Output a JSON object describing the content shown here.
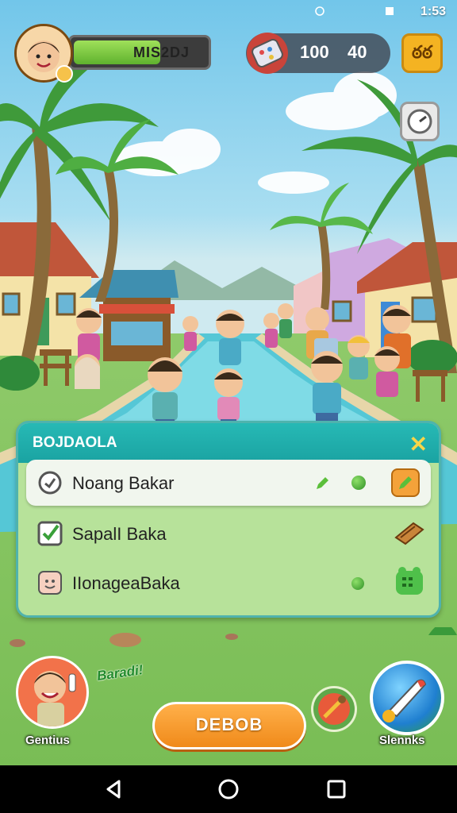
{
  "status_bar": {
    "time": "1:53"
  },
  "hud": {
    "player_name": "MIS2DJ",
    "xp_fraction": 0.65,
    "currency_a": "100",
    "currency_b": "40",
    "menu_glyph": "ఠఠ"
  },
  "panel": {
    "title": "BOJDAOLA",
    "close_glyph": "✕",
    "rows": [
      {
        "label": "Noang Bakar",
        "icon": "lock-check-icon",
        "selected": true
      },
      {
        "label": "SapalI Baka",
        "icon": "checkbox-icon",
        "selected": false
      },
      {
        "label": "IIonageaBaka",
        "icon": "face-icon",
        "selected": false
      }
    ]
  },
  "bottom": {
    "character_label": "Gentius",
    "burst_text": "Baradi!",
    "play_label": "DEBOB",
    "shop_label": "Slennks"
  },
  "colors": {
    "accent_teal": "#1fa9a6",
    "panel_green": "#b7e29a",
    "play_orange": "#f59a2a",
    "hud_green": "#6bbf32"
  }
}
